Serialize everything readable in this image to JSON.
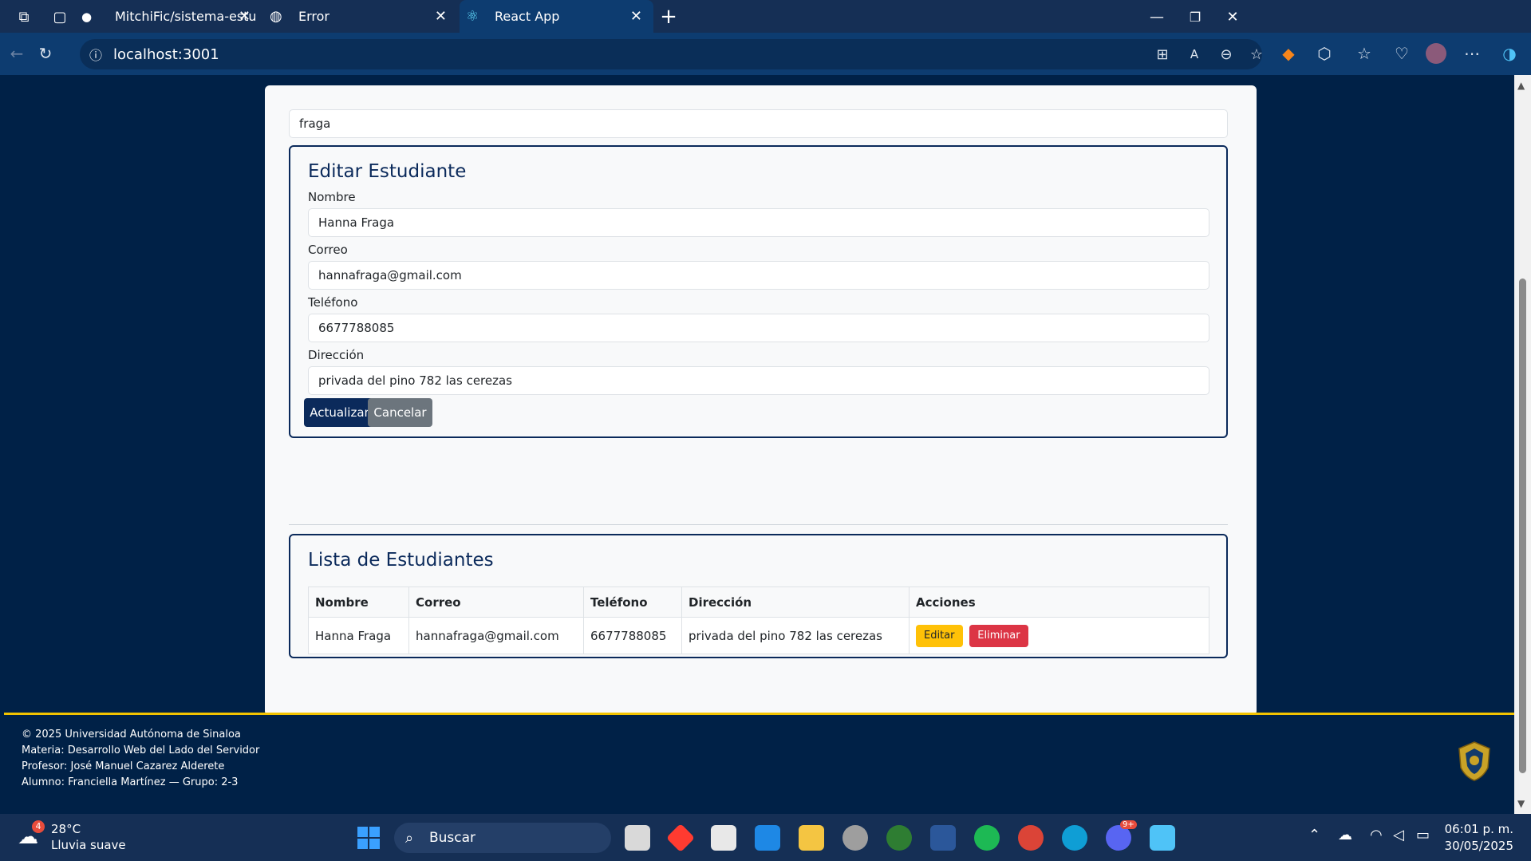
{
  "browser": {
    "tabs": [
      {
        "title": "MitchiFic/sistema-estudiantes-uas",
        "icon": "github-icon"
      },
      {
        "title": "Error",
        "icon": "globe-icon"
      },
      {
        "title": "React App",
        "icon": "react-icon"
      }
    ],
    "url": "localhost:3001",
    "accent": "#0d3c70"
  },
  "search": {
    "value": "fraga"
  },
  "form": {
    "title": "Editar Estudiante",
    "fields": [
      {
        "label": "Nombre",
        "value": "Hanna Fraga"
      },
      {
        "label": "Correo",
        "value": "hannafraga@gmail.com"
      },
      {
        "label": "Teléfono",
        "value": "6677788085"
      },
      {
        "label": "Dirección",
        "value": "privada del pino 782 las cerezas"
      }
    ],
    "update_label": "Actualizar",
    "cancel_label": "Cancelar"
  },
  "list": {
    "title": "Lista de Estudiantes",
    "columns": [
      "Nombre",
      "Correo",
      "Teléfono",
      "Dirección",
      "Acciones"
    ],
    "rows": [
      {
        "nombre": "Hanna Fraga",
        "correo": "hannafraga@gmail.com",
        "telefono": "6677788085",
        "direccion": "privada del pino 782 las cerezas",
        "edit_label": "Editar",
        "delete_label": "Eliminar"
      }
    ]
  },
  "footer": {
    "line1": "© 2025 Universidad Autónoma de Sinaloa",
    "line2": "Materia: Desarrollo Web del Lado del Servidor",
    "line3": "Profesor: José Manuel Cazarez Alderete",
    "line4": "Alumno: Franciella Martínez — Grupo: 2-3"
  },
  "taskbar": {
    "weather_temp": "28°C",
    "weather_desc": "Lluvia suave",
    "weather_badge": "4",
    "search_label": "Buscar",
    "time": "06:01 p. m.",
    "date": "30/05/2025",
    "discord_badge": "9+"
  },
  "colors": {
    "navy": "#002147",
    "gold": "#f2c300",
    "warning": "#ffc107",
    "danger": "#dc3545",
    "secondary": "#6c757d"
  }
}
